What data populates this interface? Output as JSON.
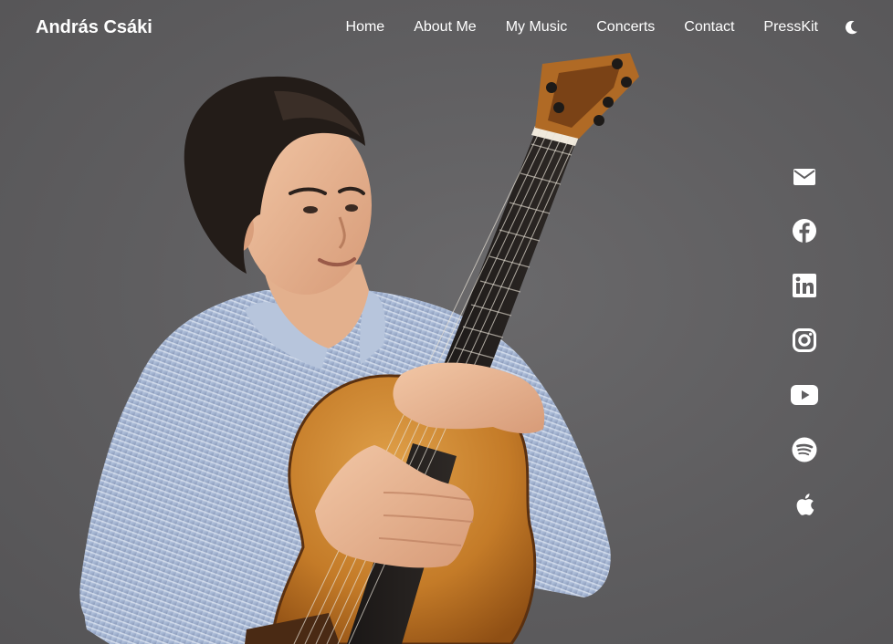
{
  "header": {
    "brand": "András Csáki",
    "nav": [
      "Home",
      "About Me",
      "My Music",
      "Concerts",
      "Contact",
      "PressKit"
    ],
    "theme_toggle_icon": "moon-icon"
  },
  "social_icons": [
    "mail-icon",
    "facebook-icon",
    "linkedin-icon",
    "instagram-icon",
    "youtube-icon",
    "spotify-icon",
    "apple-icon"
  ],
  "colors": {
    "background": "#5f5e60",
    "text": "#ffffff",
    "guitar_wood": "#c67e2a",
    "shirt": "#a9bad6"
  }
}
